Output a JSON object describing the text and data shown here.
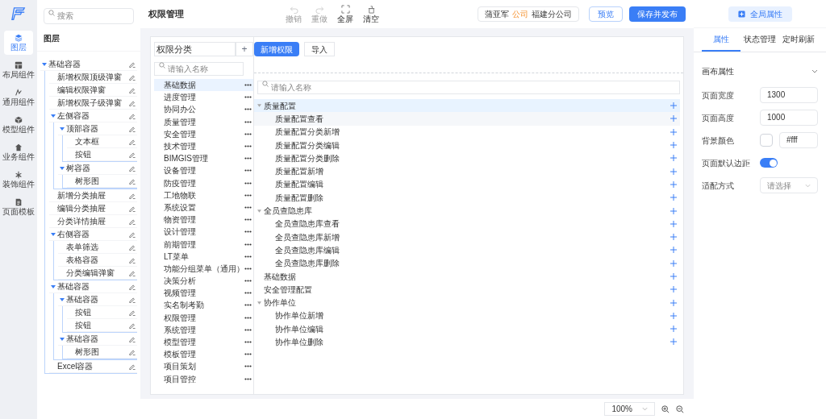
{
  "rail": [
    {
      "label": "图层",
      "selected": true
    },
    {
      "label": "布局组件",
      "selected": false
    },
    {
      "label": "通用组件",
      "selected": false
    },
    {
      "label": "模型组件",
      "selected": false
    },
    {
      "label": "业务组件",
      "selected": false
    },
    {
      "label": "装饰组件",
      "selected": false
    },
    {
      "label": "页面模板",
      "selected": false
    }
  ],
  "layers": {
    "search": {
      "placeholder": "搜索"
    },
    "title": "图层",
    "tree": [
      {
        "label": "基础容器",
        "expanded": true,
        "children": [
          {
            "label": "新增权限顶级弹窗"
          },
          {
            "label": "编辑权限弹窗"
          },
          {
            "label": "新增权限子级弹窗"
          },
          {
            "label": "左侧容器",
            "expanded": true,
            "children": [
              {
                "label": "顶部容器",
                "expanded": true,
                "children": [
                  {
                    "label": "文本框"
                  },
                  {
                    "label": "按钮"
                  }
                ]
              },
              {
                "label": "树容器",
                "expanded": true,
                "children": [
                  {
                    "label": "树形图"
                  }
                ]
              }
            ]
          },
          {
            "label": "新增分类抽屉"
          },
          {
            "label": "编辑分类抽屉"
          },
          {
            "label": "分类详情抽屉"
          },
          {
            "label": "右侧容器",
            "expanded": true,
            "children": [
              {
                "label": "表单筛选"
              },
              {
                "label": "表格容器"
              },
              {
                "label": "分类编辑弹窗"
              }
            ]
          },
          {
            "label": "基础容器",
            "expanded": true,
            "children": [
              {
                "label": "基础容器",
                "expanded": true,
                "children": [
                  {
                    "label": "按钮"
                  },
                  {
                    "label": "按钮"
                  }
                ]
              },
              {
                "label": "基础容器",
                "expanded": true,
                "children": [
                  {
                    "label": "树形图"
                  }
                ]
              }
            ]
          },
          {
            "label": "Excel容器"
          }
        ]
      }
    ]
  },
  "toolbar": {
    "title": "权限管理",
    "tools": [
      {
        "label": "撤销",
        "kind": "undo",
        "disabled": true
      },
      {
        "label": "重做",
        "kind": "redo",
        "disabled": true
      },
      {
        "label": "全屏",
        "kind": "fullscreen",
        "disabled": false
      },
      {
        "label": "清空",
        "kind": "clear",
        "disabled": false
      }
    ],
    "user": {
      "name": "蒲亚军",
      "tag": "公司",
      "org": "福建分公司"
    },
    "buttons": [
      {
        "label": "预览",
        "kind": "outline"
      },
      {
        "label": "保存并发布",
        "kind": "primary"
      }
    ]
  },
  "canvas": {
    "category": {
      "title": "权限分类",
      "add": "+",
      "search": {
        "placeholder": "请输入名称"
      },
      "items": [
        {
          "label": "基础数据",
          "selected": true
        },
        {
          "label": "进度管理",
          "selected": false
        },
        {
          "label": "协同办公",
          "selected": false
        },
        {
          "label": "质量管理",
          "selected": false
        },
        {
          "label": "安全管理",
          "selected": false
        },
        {
          "label": "技术管理",
          "selected": false
        },
        {
          "label": "BIMGIS管理",
          "selected": false
        },
        {
          "label": "设备管理",
          "selected": false
        },
        {
          "label": "防疫管理",
          "selected": false
        },
        {
          "label": "工地物联",
          "selected": false
        },
        {
          "label": "系统设置",
          "selected": false
        },
        {
          "label": "物资管理",
          "selected": false
        },
        {
          "label": "设计管理",
          "selected": false
        },
        {
          "label": "前期管理",
          "selected": false
        },
        {
          "label": "LT菜单",
          "selected": false
        },
        {
          "label": "功能分组菜单（通用）",
          "selected": false
        },
        {
          "label": "决策分析",
          "selected": false
        },
        {
          "label": "视频管理",
          "selected": false
        },
        {
          "label": "实名制考勤",
          "selected": false
        },
        {
          "label": "权限管理",
          "selected": false
        },
        {
          "label": "系统管理",
          "selected": false
        },
        {
          "label": "模型管理",
          "selected": false
        },
        {
          "label": "模板管理",
          "selected": false
        },
        {
          "label": "项目策划",
          "selected": false
        },
        {
          "label": "项目管控",
          "selected": false
        }
      ]
    },
    "actions": [
      {
        "label": "新增权限",
        "kind": "primary"
      },
      {
        "label": "导入",
        "kind": "outline"
      }
    ],
    "search": {
      "placeholder": "请输入名称"
    },
    "tree": [
      {
        "label": "质量配置",
        "selected": true,
        "expanded": true,
        "children": [
          {
            "label": "质量配置查看",
            "selected": false,
            "hovered": true
          },
          {
            "label": "质量配置分类新增",
            "selected": false
          },
          {
            "label": "质量配置分类编辑",
            "selected": false
          },
          {
            "label": "质量配置分类删除",
            "selected": false
          },
          {
            "label": "质量配置新增",
            "selected": false
          },
          {
            "label": "质量配置编辑",
            "selected": false
          },
          {
            "label": "质量配置删除",
            "selected": false
          }
        ]
      },
      {
        "label": "全员查隐患库",
        "selected": false,
        "expanded": true,
        "children": [
          {
            "label": "全员查隐患库查看",
            "selected": false
          },
          {
            "label": "全员查隐患库新增",
            "selected": false
          },
          {
            "label": "全员查隐患库编辑",
            "selected": false
          },
          {
            "label": "全员查隐患库删除",
            "selected": false
          }
        ]
      },
      {
        "label": "基础数据",
        "selected": false
      },
      {
        "label": "安全管理配置",
        "selected": false
      },
      {
        "label": "协作单位",
        "selected": false,
        "expanded": true,
        "children": [
          {
            "label": "协作单位新增",
            "selected": false
          },
          {
            "label": "协作单位编辑",
            "selected": false
          },
          {
            "label": "协作单位删除",
            "selected": false
          }
        ]
      }
    ]
  },
  "properties": {
    "global_button": "全局属性",
    "tabs": [
      {
        "label": "属性",
        "selected": true
      },
      {
        "label": "状态管理",
        "selected": false
      },
      {
        "label": "定时刷新",
        "selected": false
      }
    ],
    "section": {
      "title": "画布属性",
      "expanded": true
    },
    "fields": [
      {
        "kind": "input",
        "label": "页面宽度",
        "value": "1300"
      },
      {
        "kind": "input",
        "label": "页面高度",
        "value": "1000"
      },
      {
        "kind": "color",
        "label": "背景颜色",
        "value": "#fff"
      },
      {
        "kind": "switch",
        "label": "页面默认边距",
        "on": true
      },
      {
        "kind": "select",
        "label": "适配方式",
        "placeholder": "请选择"
      }
    ]
  },
  "zoom": {
    "value": "100%"
  }
}
